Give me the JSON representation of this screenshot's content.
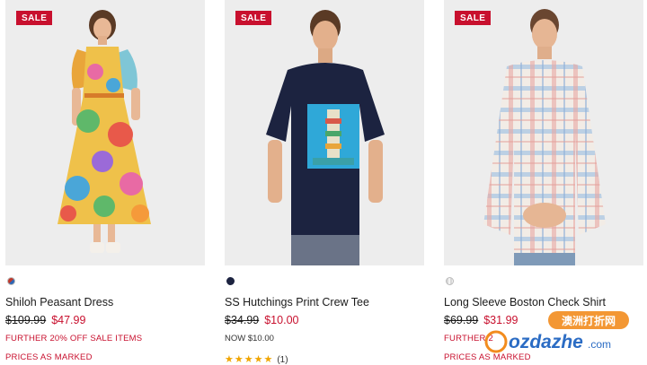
{
  "products": [
    {
      "badge": "SALE",
      "name": "Shiloh Peasant Dress",
      "was_price": "$109.99",
      "now_price": "$47.99",
      "promo1": "FURTHER 20% OFF SALE ITEMS",
      "promo2": "PRICES AS MARKED",
      "swatch_color": "#c0392b"
    },
    {
      "badge": "SALE",
      "name": "SS Hutchings Print Crew Tee",
      "was_price": "$34.99",
      "now_price": "$10.00",
      "note": "NOW $10.00",
      "stars": "★★★★★",
      "rating_count": "(1)",
      "swatch_color": "#1c2340"
    },
    {
      "badge": "SALE",
      "name": "Long Sleeve Boston Check Shirt",
      "was_price": "$69.99",
      "now_price": "$31.99",
      "promo1": "FURTHER 2",
      "promo2": "PRICES AS MARKED",
      "swatch_color": "#d8d8d8"
    }
  ],
  "watermark": {
    "top_text": "澳洲打折网",
    "brand_text": "ozdazhe",
    "suffix": ".com"
  },
  "colors": {
    "sale_red": "#c8102e",
    "star_gold": "#f0a500"
  }
}
